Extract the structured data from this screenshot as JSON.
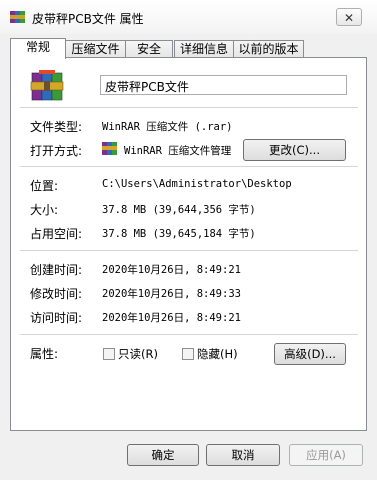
{
  "title": "皮带秤PCB文件 属性",
  "close_glyph": "✕",
  "tabs": [
    "常规",
    "压缩文件",
    "安全",
    "详细信息",
    "以前的版本"
  ],
  "file_name": "皮带秤PCB文件",
  "file_type": {
    "label": "文件类型:",
    "value": "WinRAR 压缩文件 (.rar)"
  },
  "opens_with": {
    "label": "打开方式:",
    "value": "WinRAR 压缩文件管理",
    "change_button": "更改(C)..."
  },
  "location": {
    "label": "位置:",
    "value": "C:\\Users\\Administrator\\Desktop"
  },
  "size": {
    "label": "大小:",
    "value": "37.8 MB (39,644,356 字节)"
  },
  "size_on_disk": {
    "label": "占用空间:",
    "value": "37.8 MB (39,645,184 字节)"
  },
  "created": {
    "label": "创建时间:",
    "value": "2020年10月26日, 8:49:21"
  },
  "modified": {
    "label": "修改时间:",
    "value": "2020年10月26日, 8:49:33"
  },
  "accessed": {
    "label": "访问时间:",
    "value": "2020年10月26日, 8:49:21"
  },
  "attributes": {
    "label": "属性:",
    "readonly": "只读(R)",
    "hidden": "隐藏(H)",
    "advanced_button": "高级(D)..."
  },
  "buttons": {
    "ok": "确定",
    "cancel": "取消",
    "apply": "应用(A)"
  },
  "icon_names": [
    "winrar-archive-icon",
    "winrar-small-icon",
    "close-icon"
  ]
}
